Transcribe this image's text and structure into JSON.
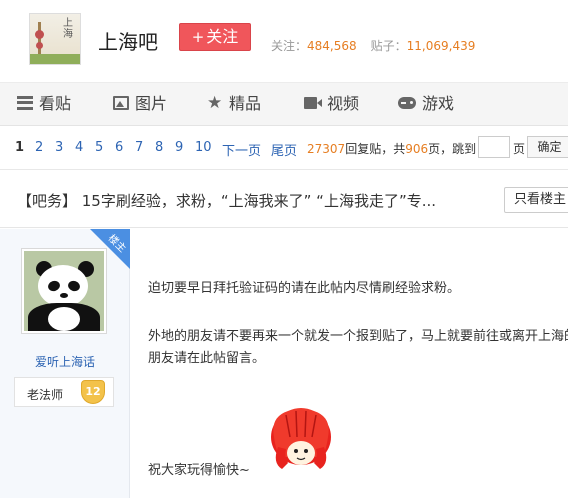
{
  "header": {
    "forum_name": "上海吧",
    "logo_calligraphy": "上海",
    "follow_label": "关注",
    "follow_plus": "+",
    "followers_label": "关注：",
    "followers_count": "484,568",
    "posts_label": "贴子：",
    "posts_count": "11,069,439"
  },
  "nav": {
    "items": [
      {
        "label": "看贴",
        "icon": "list-icon"
      },
      {
        "label": "图片",
        "icon": "picture-icon"
      },
      {
        "label": "精品",
        "icon": "star-icon"
      },
      {
        "label": "视频",
        "icon": "video-icon"
      },
      {
        "label": "游戏",
        "icon": "gamepad-icon"
      }
    ]
  },
  "pager": {
    "pages": [
      "1",
      "2",
      "3",
      "4",
      "5",
      "6",
      "7",
      "8",
      "9",
      "10"
    ],
    "current": "1",
    "next_label": "下一页",
    "last_label": "尾页",
    "reply_count": "27307",
    "reply_suffix": "回复贴，共",
    "page_count": "906",
    "page_suffix": "页，跳到",
    "jump_unit": "页",
    "jump_button": "确定"
  },
  "thread": {
    "title": "【吧务】 15字刷经验，求粉，“上海我来了” “上海我走了”专...",
    "only_op_label": "只看楼主"
  },
  "post": {
    "op_badge": "楼主",
    "author_name": "爱听上海话",
    "level_title": "老法师",
    "level_number": "12",
    "paragraphs": [
      "迫切要早日拜托验证码的请在此帖内尽情刷经验求粉。",
      "外地的朋友请不要再来一个就发一个报到贴了，马上就要前往或离开上海的朋友请在此帖留言。",
      "祝大家玩得愉快~"
    ],
    "emoji_icon": "red-haired-cartoon-emoji",
    "colors": {
      "accent_red": "#f0565b",
      "link_blue": "#2d64b3",
      "number_orange": "#e67e22",
      "op_badge_blue": "#4b8fe2"
    }
  }
}
